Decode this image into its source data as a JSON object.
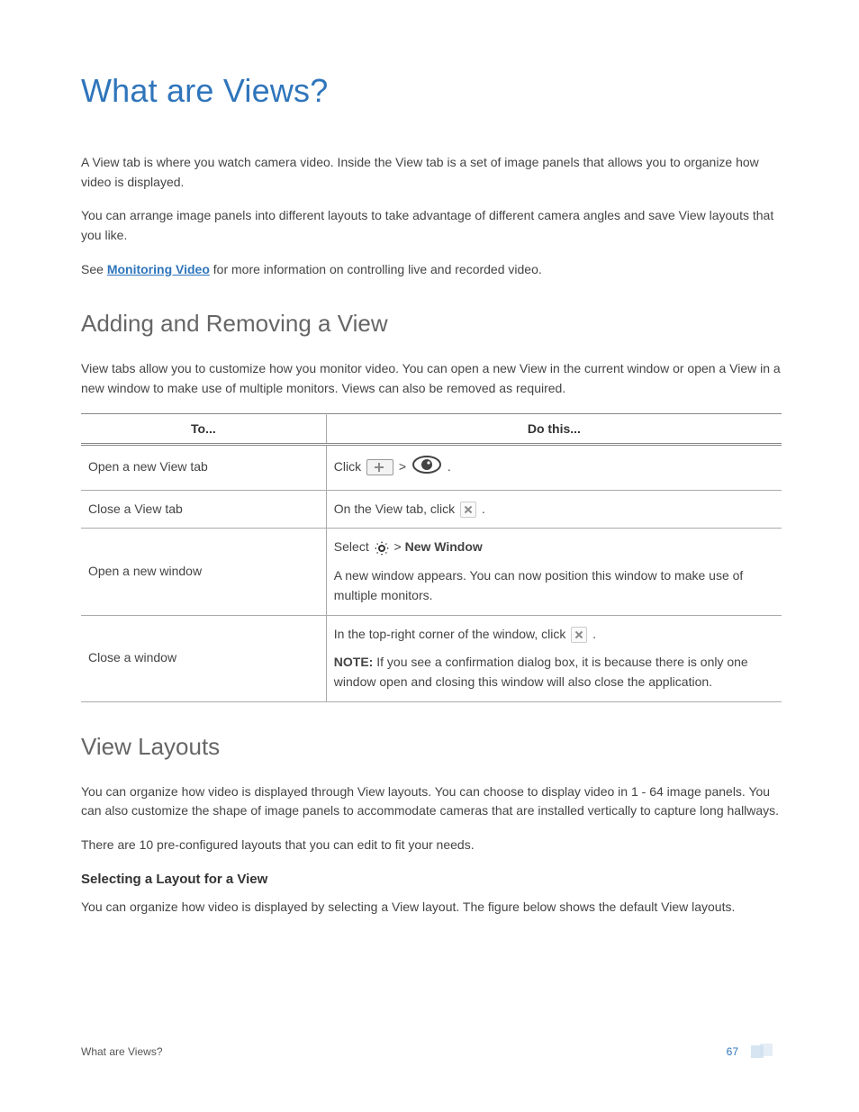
{
  "title": "What are Views?",
  "intro_p1": "A View tab is where you watch camera video. Inside the View tab is a set of image panels that allows you to organize how video is displayed.",
  "intro_p2": "You can arrange image panels into different layouts to take advantage of different camera angles and save View layouts that you like.",
  "see_prefix": "See ",
  "see_link": "Monitoring Video",
  "see_suffix": " for more information on controlling live and recorded video.",
  "section_add_remove": {
    "heading": "Adding and Removing a View",
    "desc": "View tabs allow you to customize how you monitor video. You can open a new View in the current window or open a View in a new window to make use of multiple monitors. Views can also be removed as required.",
    "th_to": "To...",
    "th_do": "Do this...",
    "rows": {
      "r0_to": "Open a new View tab",
      "r0_do_pre": "Click ",
      "r0_do_mid": " > ",
      "r0_do_post": " .",
      "r1_to": "Close a View tab",
      "r1_do_pre": "On the View tab, click ",
      "r1_do_post": " .",
      "r2_to": "Open a new window",
      "r2_do_l1a": "Select ",
      "r2_do_l1b": " > ",
      "r2_do_l1c": "New Window",
      "r2_do_l2": "A new window appears. You can now position this window to make use of multiple monitors.",
      "r3_to": "Close a window",
      "r3_do_l1a": "In the top-right corner of the window, click ",
      "r3_do_l1b": " .",
      "r3_do_l2a": "NOTE:",
      "r3_do_l2b": " If you see a confirmation dialog box, it is because there is only one window open and closing this window will also close the application."
    }
  },
  "section_layouts": {
    "heading": "View Layouts",
    "p1": "You can organize how video is displayed through View layouts. You can choose to display video in 1 - 64 image panels. You can also customize the shape of image panels to accommodate cameras that are installed vertically to capture long hallways.",
    "p2": "There are 10 pre-configured layouts that you can edit to fit your needs.",
    "sub_heading": "Selecting a Layout for a View",
    "sub_p": "You can organize how video is displayed by selecting a View layout. The figure below shows the default View layouts."
  },
  "footer": {
    "left": "What are Views?",
    "page": "67"
  }
}
